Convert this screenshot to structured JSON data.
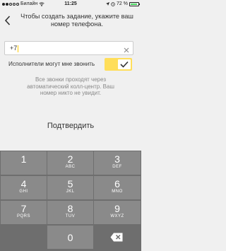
{
  "status_bar": {
    "carrier": "Билайн",
    "time": "11:25",
    "battery": "72 %"
  },
  "header": {
    "title": "Чтобы создать задание, укажите ваш номер телефона."
  },
  "phone": {
    "value": "+7"
  },
  "callers": {
    "label": "Исполнители могут мне звонить",
    "enabled": true
  },
  "note": "Все звонки проходят через автоматический колл-центр. Ваш номер никто не увидит.",
  "confirm_label": "Подтвердить",
  "keypad": {
    "k1": {
      "num": "1",
      "sub": ""
    },
    "k2": {
      "num": "2",
      "sub": "ABC"
    },
    "k3": {
      "num": "3",
      "sub": "DEF"
    },
    "k4": {
      "num": "4",
      "sub": "GHI"
    },
    "k5": {
      "num": "5",
      "sub": "JKL"
    },
    "k6": {
      "num": "6",
      "sub": "MNO"
    },
    "k7": {
      "num": "7",
      "sub": "PQRS"
    },
    "k8": {
      "num": "8",
      "sub": "TUV"
    },
    "k9": {
      "num": "9",
      "sub": "WXYZ"
    },
    "k0": {
      "num": "0"
    }
  },
  "colors": {
    "toggle": "#ffde5a",
    "keypad_bg": "#6e6e6e",
    "key": "#8a8a8a"
  },
  "icons": {
    "back": "chevron-left-icon",
    "clear": "clear-circle-icon",
    "check": "checkmark-icon",
    "backspace": "backspace-icon"
  }
}
